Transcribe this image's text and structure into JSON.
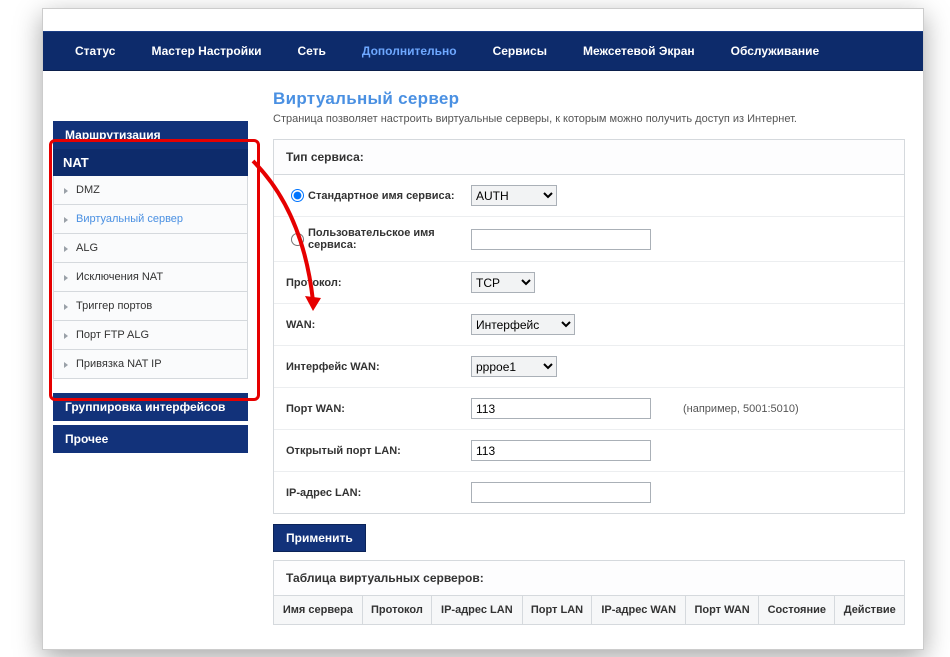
{
  "topnav": {
    "items": [
      {
        "label": "Статус"
      },
      {
        "label": "Мастер Настройки"
      },
      {
        "label": "Сеть"
      },
      {
        "label": "Дополнительно"
      },
      {
        "label": "Сервисы"
      },
      {
        "label": "Межсетевой Экран"
      },
      {
        "label": "Обслуживание"
      }
    ],
    "active_index": 3
  },
  "sidebar": {
    "sections": [
      {
        "type": "hdr",
        "label": "Маршрутизация"
      },
      {
        "type": "cat",
        "label": "NAT"
      },
      {
        "type": "item",
        "label": "DMZ"
      },
      {
        "type": "item",
        "label": "Виртуальный сервер",
        "active": true
      },
      {
        "type": "item",
        "label": "ALG"
      },
      {
        "type": "item",
        "label": "Исключения NAT"
      },
      {
        "type": "item",
        "label": "Триггер портов"
      },
      {
        "type": "item",
        "label": "Порт FTP ALG"
      },
      {
        "type": "item",
        "label": "Привязка NAT IP"
      },
      {
        "type": "gap"
      },
      {
        "type": "hdr",
        "label": "Группировка интерфейсов"
      },
      {
        "type": "gap2"
      },
      {
        "type": "hdr",
        "label": "Прочее"
      }
    ]
  },
  "page": {
    "title": "Виртуальный сервер",
    "desc": "Страница позволяет настроить виртуальные серверы, к которым можно получить доступ из Интернет."
  },
  "form": {
    "panel_title": "Тип сервиса:",
    "std_label": "Стандартное имя сервиса:",
    "std_value": "AUTH",
    "custom_label": "Пользовательское имя сервиса:",
    "custom_value": "",
    "proto_label": "Протокол:",
    "proto_value": "TCP",
    "wan_label": "WAN:",
    "wan_value": "Интерфейс",
    "wanif_label": "Интерфейс WAN:",
    "wanif_value": "pppoe1",
    "wanport_label": "Порт WAN:",
    "wanport_value": "113",
    "wanport_hint": "(например, 5001:5010)",
    "lanport_label": "Открытый порт LAN:",
    "lanport_value": "113",
    "lanip_label": "IP-адрес LAN:",
    "lanip_value": "",
    "apply": "Применить"
  },
  "table": {
    "title": "Таблица виртуальных серверов:",
    "cols": [
      "Имя сервера",
      "Протокол",
      "IP-адрес LAN",
      "Порт LAN",
      "IP-адрес WAN",
      "Порт WAN",
      "Состояние",
      "Действие"
    ]
  }
}
